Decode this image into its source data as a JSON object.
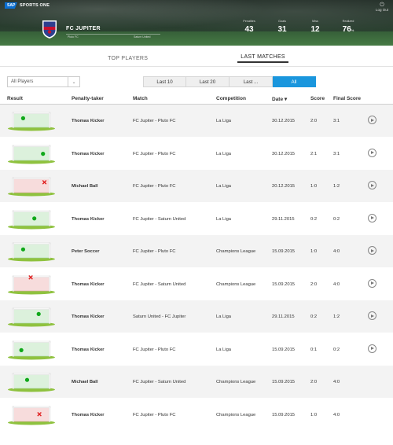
{
  "header": {
    "brand_logo": "SAP",
    "brand_name": "SPORTS ONE",
    "logout_label": "Log Out",
    "team_name": "FC JUPITER",
    "team_sub_left": "Pluto FC",
    "team_sub_right": "Saturn United",
    "stats": [
      {
        "label": "Penalties",
        "value": "43",
        "unit": ""
      },
      {
        "label": "Goals",
        "value": "31",
        "unit": ""
      },
      {
        "label": "Miss",
        "value": "12",
        "unit": ""
      },
      {
        "label": "Realized",
        "value": "76",
        "unit": "%"
      }
    ],
    "colors": {
      "crest_blue": "#2e3f8f",
      "crest_red": "#c8102e"
    }
  },
  "tabs": [
    {
      "label": "TOP PLAYERS",
      "active": false
    },
    {
      "label": "LAST MATCHES",
      "active": true
    }
  ],
  "filters": {
    "player_select": "All Players",
    "periods": [
      {
        "label": "Last 10",
        "active": false
      },
      {
        "label": "Last 20",
        "active": false
      },
      {
        "label": "Last ...",
        "active": false
      },
      {
        "label": "All",
        "active": true
      }
    ],
    "accent_color": "#1a96dd"
  },
  "table": {
    "headers": {
      "result": "Result",
      "taker": "Penalty-taker",
      "match": "Match",
      "competition": "Competition",
      "date": "Date ▾",
      "score": "Score",
      "final": "Final Score"
    },
    "rows": [
      {
        "outcome": "goal",
        "shot": "left-mid",
        "taker": "Thomas Kicker",
        "match": "FC Jupiter - Pluto FC",
        "competition": "La Liga",
        "date": "30.12.2015",
        "score": "2:0",
        "final": "3:1",
        "video": true
      },
      {
        "outcome": "goal",
        "shot": "right-low",
        "taker": "Thomas Kicker",
        "match": "FC Jupiter - Pluto FC",
        "competition": "La Liga",
        "date": "30.12.2015",
        "score": "2:1",
        "final": "3:1",
        "video": true
      },
      {
        "outcome": "miss",
        "shot": "right-out",
        "taker": "Michael Ball",
        "match": "FC Jupiter - Pluto FC",
        "competition": "La Liga",
        "date": "20.12.2015",
        "score": "1:0",
        "final": "1:2",
        "video": true
      },
      {
        "outcome": "goal",
        "shot": "center-low",
        "taker": "Thomas Kicker",
        "match": "FC Jupiter - Saturn United",
        "competition": "La Liga",
        "date": "29.11.2015",
        "score": "0:2",
        "final": "0:2",
        "video": true
      },
      {
        "outcome": "goal",
        "shot": "left-low",
        "taker": "Peter Soccer",
        "match": "FC Jupiter - Pluto FC",
        "competition": "Champions League",
        "date": "15.09.2015",
        "score": "1:0",
        "final": "4:0",
        "video": true
      },
      {
        "outcome": "miss",
        "shot": "left-top",
        "taker": "Thomas Kicker",
        "match": "FC Jupiter - Saturn United",
        "competition": "Champions League",
        "date": "15.09.2015",
        "score": "2:0",
        "final": "4:0",
        "video": true
      },
      {
        "outcome": "goal",
        "shot": "right-mid",
        "taker": "Thomas Kicker",
        "match": "Saturn United - FC Jupiter",
        "competition": "La Liga",
        "date": "29.11.2015",
        "score": "0:2",
        "final": "1:2",
        "video": true
      },
      {
        "outcome": "goal",
        "shot": "left-lowest",
        "taker": "Thomas Kicker",
        "match": "FC Jupiter - Pluto FC",
        "competition": "La Liga",
        "date": "15.09.2015",
        "score": "0:1",
        "final": "0:2",
        "video": true
      },
      {
        "outcome": "goal",
        "shot": "left-mid2",
        "taker": "Michael Ball",
        "match": "FC Jupiter - Saturn United",
        "competition": "Champions League",
        "date": "15.09.2015",
        "score": "2:0",
        "final": "4:0",
        "video": false
      },
      {
        "outcome": "miss",
        "shot": "right-low-in",
        "taker": "Thomas Kicker",
        "match": "FC Jupiter - Pluto FC",
        "competition": "Champions League",
        "date": "15.09.2015",
        "score": "1:0",
        "final": "4:0",
        "video": false
      }
    ]
  }
}
